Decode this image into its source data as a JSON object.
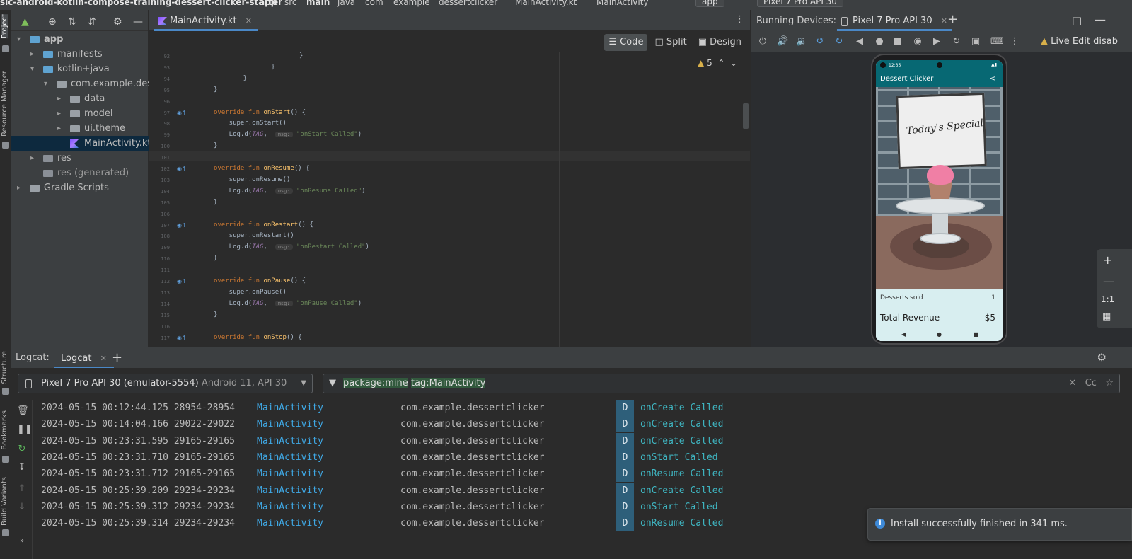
{
  "breadcrumb": {
    "project": "sic-android-kotlin-compose-training-dessert-clicker-starter",
    "items": [
      "app",
      "src",
      "main",
      "java",
      "com",
      "example",
      "dessertclicker",
      "MainActivity.kt",
      "MainActivity"
    ],
    "run_config": "app",
    "device_config": "Pixel 7 Pro API 30"
  },
  "left_strip": {
    "project": "Project",
    "resource_manager": "Resource Manager",
    "structure": "Structure",
    "bookmarks": "Bookmarks",
    "build_variants": "Build Variants"
  },
  "project_tree": [
    {
      "label": "app",
      "depth": 0,
      "expanded": true,
      "icon": "app-module-icon"
    },
    {
      "label": "manifests",
      "depth": 1,
      "expanded": false,
      "icon": "folder-icon"
    },
    {
      "label": "kotlin+java",
      "depth": 1,
      "expanded": true,
      "icon": "folder-icon"
    },
    {
      "label": "com.example.desse",
      "depth": 2,
      "expanded": true,
      "icon": "package-icon"
    },
    {
      "label": "data",
      "depth": 3,
      "expanded": false,
      "icon": "package-icon"
    },
    {
      "label": "model",
      "depth": 3,
      "expanded": false,
      "icon": "package-icon"
    },
    {
      "label": "ui.theme",
      "depth": 3,
      "expanded": false,
      "icon": "package-icon"
    },
    {
      "label": "MainActivity.kt",
      "depth": 3,
      "selected": true,
      "icon": "kotlin-file-icon"
    },
    {
      "label": "res",
      "depth": 1,
      "expanded": false,
      "icon": "res-folder-icon"
    },
    {
      "label": "res (generated)",
      "depth": 1,
      "icon": "res-folder-icon"
    },
    {
      "label": "Gradle Scripts",
      "depth": 0,
      "expanded": false,
      "icon": "gradle-icon"
    }
  ],
  "editor": {
    "tab": "MainActivity.kt",
    "modes": [
      "Code",
      "Split",
      "Design"
    ],
    "active_mode": "Code",
    "warnings": "5",
    "lines": [
      {
        "n": "92",
        "code": "            }"
      },
      {
        "n": "93",
        "code": "        }"
      },
      {
        "n": "94",
        "code": "    }"
      },
      {
        "n": "95",
        "code": "}"
      },
      {
        "n": "96",
        "code": ""
      },
      {
        "n": "97",
        "kw": "override fun ",
        "fn": "onStart",
        "rest": "() {",
        "override": true
      },
      {
        "n": "98",
        "code": "    super.onStart()"
      },
      {
        "n": "99",
        "log": "onStart Called"
      },
      {
        "n": "100",
        "code": "}"
      },
      {
        "n": "101",
        "code": ""
      },
      {
        "n": "102",
        "kw": "override fun ",
        "fn": "onResume",
        "rest": "() {",
        "override": true
      },
      {
        "n": "103",
        "code": "    super.onResume()"
      },
      {
        "n": "104",
        "log": "onResume Called"
      },
      {
        "n": "105",
        "code": "}"
      },
      {
        "n": "106",
        "code": ""
      },
      {
        "n": "107",
        "kw": "override fun ",
        "fn": "onRestart",
        "rest": "() {",
        "override": true
      },
      {
        "n": "108",
        "code": "    super.onRestart()"
      },
      {
        "n": "109",
        "log": "onRestart Called"
      },
      {
        "n": "110",
        "code": "}"
      },
      {
        "n": "111",
        "code": ""
      },
      {
        "n": "112",
        "kw": "override fun ",
        "fn": "onPause",
        "rest": "() {",
        "override": true
      },
      {
        "n": "113",
        "code": "    super.onPause()"
      },
      {
        "n": "114",
        "log": "onPause Called"
      },
      {
        "n": "115",
        "code": "}"
      },
      {
        "n": "116",
        "code": ""
      },
      {
        "n": "117",
        "kw": "override fun ",
        "fn": "onStop",
        "rest": "() {",
        "override": true
      }
    ],
    "log_prefix": "    Log.d(",
    "log_tag": "TAG",
    "log_hint": "msg:",
    "log_suffix": ")"
  },
  "running_devices": {
    "title": "Running Devices:",
    "tab": "Pixel 7 Pro API 30",
    "live_edit": "Live Edit disab",
    "zoom_label": "1:1"
  },
  "phone": {
    "status_time": "12:35",
    "app_title": "Dessert Clicker",
    "sign_text": "Today's Special",
    "desserts_sold_label": "Desserts sold",
    "desserts_sold_value": "1",
    "total_revenue_label": "Total Revenue",
    "total_revenue_value": "$5"
  },
  "logcat": {
    "title": "Logcat:",
    "tab": "Logcat",
    "device": "Pixel 7 Pro API 30 (emulator-5554)",
    "device_sub": "Android 11, API 30",
    "filter_package": "package:mine",
    "filter_tag": "tag:MainActivity",
    "filter_right": "Cc",
    "rows": [
      {
        "ts": "2024-05-15 00:12:44.125 28954-28954",
        "tag": "MainActivity",
        "pkg": "com.example.dessertclicker",
        "lvl": "D",
        "msg": "onCreate Called"
      },
      {
        "ts": "2024-05-15 00:14:04.166 29022-29022",
        "tag": "MainActivity",
        "pkg": "com.example.dessertclicker",
        "lvl": "D",
        "msg": "onCreate Called"
      },
      {
        "ts": "2024-05-15 00:23:31.595 29165-29165",
        "tag": "MainActivity",
        "pkg": "com.example.dessertclicker",
        "lvl": "D",
        "msg": "onCreate Called"
      },
      {
        "ts": "2024-05-15 00:23:31.710 29165-29165",
        "tag": "MainActivity",
        "pkg": "com.example.dessertclicker",
        "lvl": "D",
        "msg": "onStart Called"
      },
      {
        "ts": "2024-05-15 00:23:31.712 29165-29165",
        "tag": "MainActivity",
        "pkg": "com.example.dessertclicker",
        "lvl": "D",
        "msg": "onResume Called"
      },
      {
        "ts": "2024-05-15 00:25:39.209 29234-29234",
        "tag": "MainActivity",
        "pkg": "com.example.dessertclicker",
        "lvl": "D",
        "msg": "onCreate Called"
      },
      {
        "ts": "2024-05-15 00:25:39.312 29234-29234",
        "tag": "MainActivity",
        "pkg": "com.example.dessertclicker",
        "lvl": "D",
        "msg": "onStart Called"
      },
      {
        "ts": "2024-05-15 00:25:39.314 29234-29234",
        "tag": "MainActivity",
        "pkg": "com.example.dessertclicker",
        "lvl": "D",
        "msg": "onResume Called"
      }
    ]
  },
  "notification": {
    "text": "Install successfully finished in 341 ms."
  },
  "colors": {
    "accent": "#4a88c7",
    "tag_blue": "#3fa9e6",
    "msg_teal": "#3fb6c2",
    "app_bar": "#076873"
  }
}
